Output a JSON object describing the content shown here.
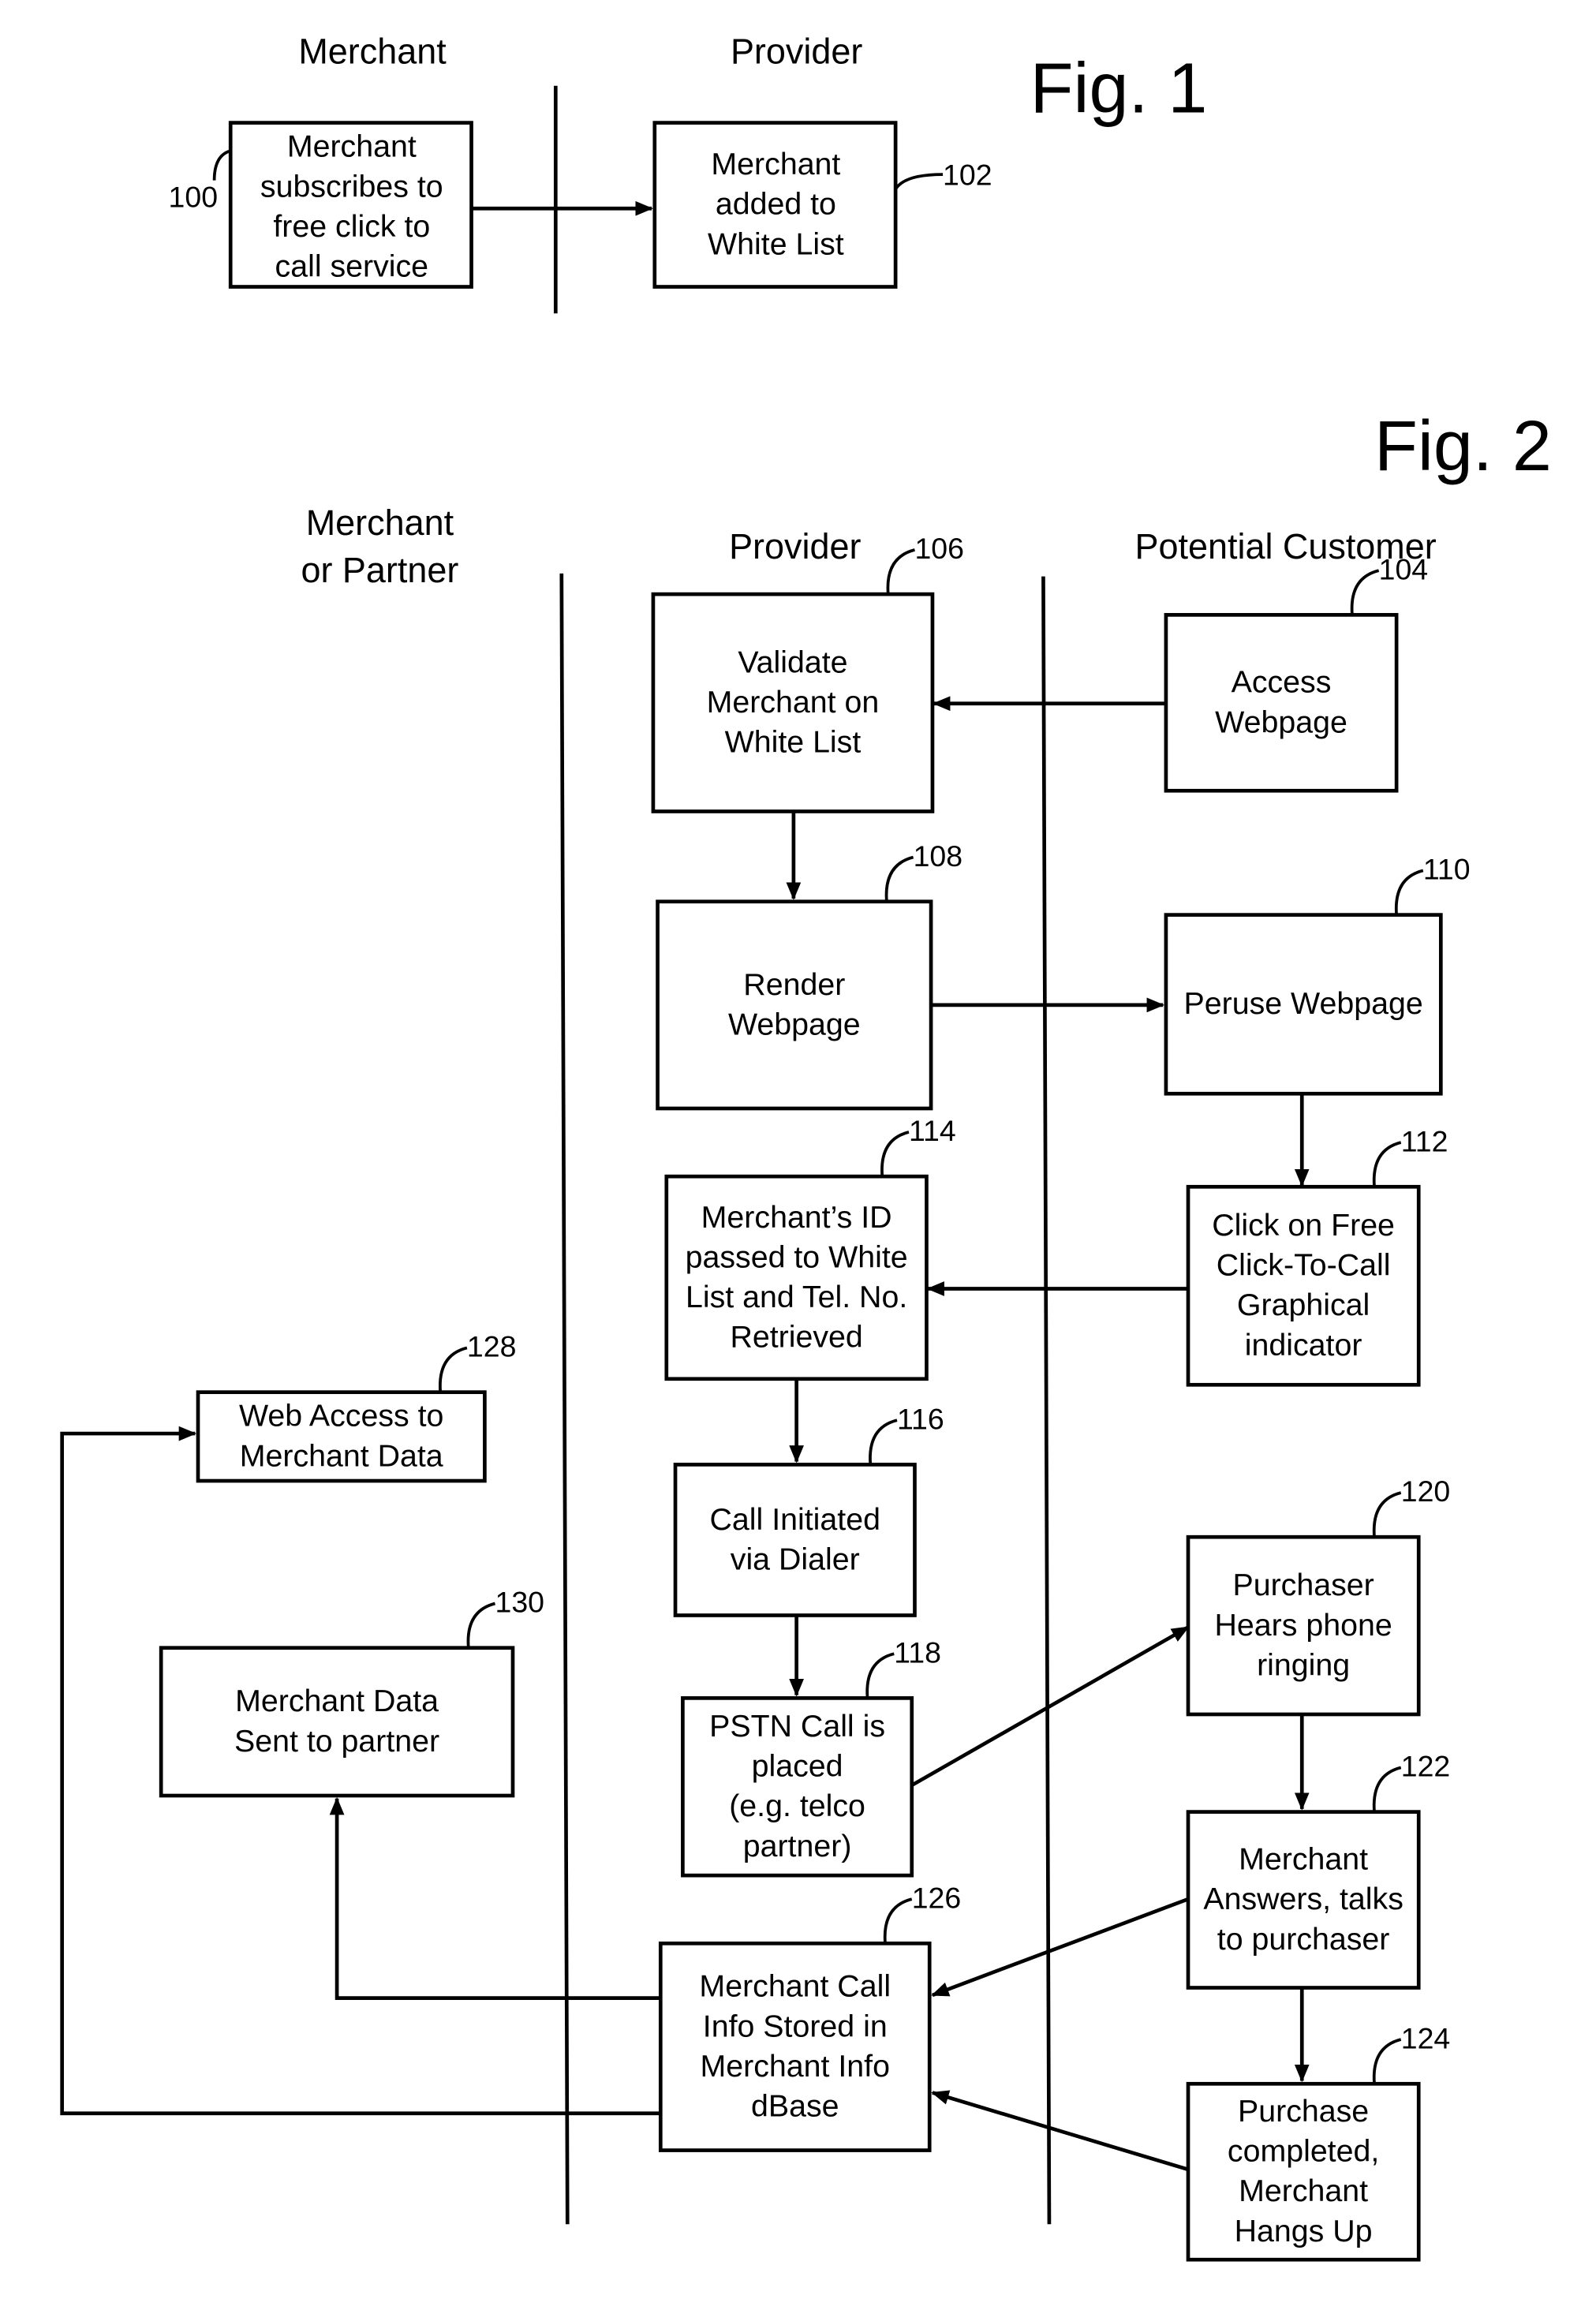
{
  "fig1": {
    "title": "Fig. 1",
    "lanes": [
      "Merchant",
      "Provider"
    ],
    "boxes": [
      {
        "ref": "100",
        "lines": [
          "Merchant",
          "subscribes to",
          "free click to",
          "call service"
        ]
      },
      {
        "ref": "102",
        "lines": [
          "Merchant",
          "added to",
          "White List"
        ]
      }
    ]
  },
  "fig2": {
    "title": "Fig. 2",
    "lanes": [
      "Merchant or Partner",
      "Provider",
      "Potential Customer"
    ],
    "lane_lines": [
      [
        "Merchant",
        "or Partner"
      ],
      [
        "Provider"
      ],
      [
        "Potential Customer"
      ]
    ],
    "boxes": [
      {
        "ref": "104",
        "lines": [
          "Access",
          "Webpage"
        ]
      },
      {
        "ref": "106",
        "lines": [
          "Validate",
          "Merchant on",
          "White List"
        ]
      },
      {
        "ref": "108",
        "lines": [
          "Render",
          "Webpage"
        ]
      },
      {
        "ref": "110",
        "lines": [
          "Peruse Webpage"
        ]
      },
      {
        "ref": "112",
        "lines": [
          "Click on Free",
          "Click-To-Call",
          "Graphical",
          "indicator"
        ]
      },
      {
        "ref": "114",
        "lines": [
          "Merchant’s  ID",
          "passed to White",
          "List and Tel. No.",
          "Retrieved"
        ]
      },
      {
        "ref": "116",
        "lines": [
          "Call Initiated",
          "via Dialer"
        ]
      },
      {
        "ref": "118",
        "lines": [
          "PSTN Call is",
          "placed",
          "(e.g. telco",
          "partner)"
        ]
      },
      {
        "ref": "120",
        "lines": [
          "Purchaser",
          "Hears phone",
          "ringing"
        ]
      },
      {
        "ref": "122",
        "lines": [
          "Merchant",
          "Answers, talks",
          "to purchaser"
        ]
      },
      {
        "ref": "124",
        "lines": [
          "Purchase",
          "completed,",
          "Merchant",
          "Hangs Up"
        ]
      },
      {
        "ref": "126",
        "lines": [
          "Merchant Call",
          "Info Stored in",
          "Merchant Info",
          "dBase"
        ]
      },
      {
        "ref": "128",
        "lines": [
          "Web Access to",
          "Merchant Data"
        ]
      },
      {
        "ref": "130",
        "lines": [
          "Merchant Data",
          "Sent to partner"
        ]
      }
    ]
  }
}
